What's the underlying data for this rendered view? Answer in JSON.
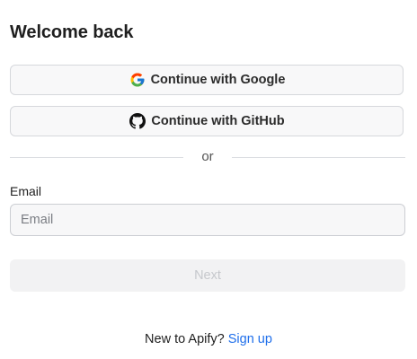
{
  "heading": "Welcome back",
  "oauth": {
    "google_label": "Continue with Google",
    "github_label": "Continue with GitHub",
    "google_icon": "google-logo-icon",
    "github_icon": "github-logo-icon"
  },
  "divider_text": "or",
  "email": {
    "label": "Email",
    "placeholder": "Email",
    "value": ""
  },
  "next_button": {
    "label": "Next",
    "disabled": true
  },
  "footer": {
    "prompt": "New to Apify?",
    "signup_link": "Sign up"
  },
  "colors": {
    "link": "#1f6feb",
    "button_bg": "#f8f8f9",
    "disabled_text": "#c6c8cc"
  }
}
